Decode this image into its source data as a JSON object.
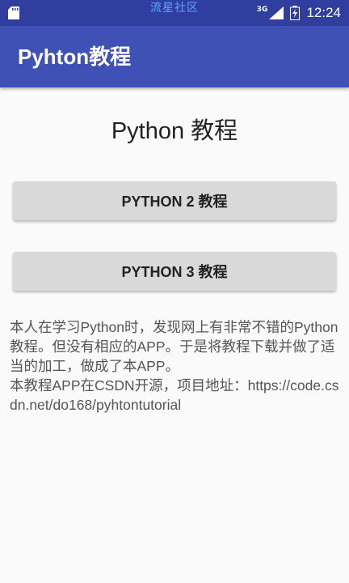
{
  "status_bar": {
    "watermark": "流星社区",
    "network_type": "3G",
    "time": "12:24",
    "sd_icon": "sd-card-icon",
    "signal_icon": "signal-icon",
    "battery_icon": "battery-charging-icon"
  },
  "app_bar": {
    "title": "Pyhton教程"
  },
  "main": {
    "title": "Python 教程",
    "buttons": [
      {
        "label": "PYTHON 2 教程"
      },
      {
        "label": "PYTHON 3 教程"
      }
    ],
    "description": {
      "line1": "本人在学习Python时，发现网上有非常不错的Python教程。但没有相应的APP。于是将教程下载并做了适当的加工，做成了本APP。",
      "line2": "本教程APP在CSDN开源，项目地址：https://code.csdn.net/do168/pyhtontutorial"
    }
  },
  "colors": {
    "status_bar": "#303f9f",
    "app_bar": "#3f51b5",
    "background": "#fafafa",
    "button": "#d9d9d9"
  }
}
